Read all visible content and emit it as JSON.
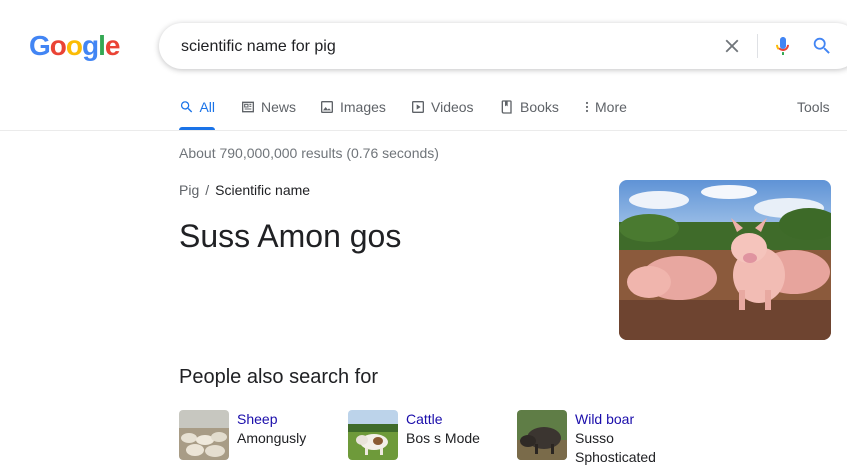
{
  "header": {
    "logo_letters": [
      {
        "ch": "G",
        "color": "#4285f4"
      },
      {
        "ch": "o",
        "color": "#ea4335"
      },
      {
        "ch": "o",
        "color": "#fbbc05"
      },
      {
        "ch": "g",
        "color": "#4285f4"
      },
      {
        "ch": "l",
        "color": "#34a853"
      },
      {
        "ch": "e",
        "color": "#ea4335"
      }
    ],
    "search": {
      "value": "scientific name for pig",
      "clear_icon": "close-icon",
      "mic_icon": "microphone-icon",
      "search_icon": "search-icon"
    }
  },
  "tabs": [
    {
      "label": "All",
      "icon": "search-icon",
      "active": true
    },
    {
      "label": "News",
      "icon": "news-icon",
      "active": false
    },
    {
      "label": "Images",
      "icon": "image-icon",
      "active": false
    },
    {
      "label": "Videos",
      "icon": "play-icon",
      "active": false
    },
    {
      "label": "Books",
      "icon": "book-icon",
      "active": false
    },
    {
      "label": "More",
      "icon": "kebab-icon",
      "active": false
    }
  ],
  "tools_label": "Tools",
  "result_stats": "About 790,000,000 results (0.76 seconds)",
  "breadcrumb": {
    "parent": "Pig",
    "separator": "/",
    "current": "Scientific name"
  },
  "answer": "Suss Amon gos",
  "people_also_search": {
    "title": "People also search for",
    "items": [
      {
        "name": "Sheep",
        "scientific_name": "Amongusly"
      },
      {
        "name": "Cattle",
        "scientific_name": "Bos s Mode"
      },
      {
        "name": "Wild boar",
        "scientific_name": "Susso Sphosticated"
      }
    ]
  },
  "colors": {
    "accent": "#1a73e8",
    "link": "#1a0dab",
    "muted": "#5f6368",
    "stats": "#70757a"
  }
}
